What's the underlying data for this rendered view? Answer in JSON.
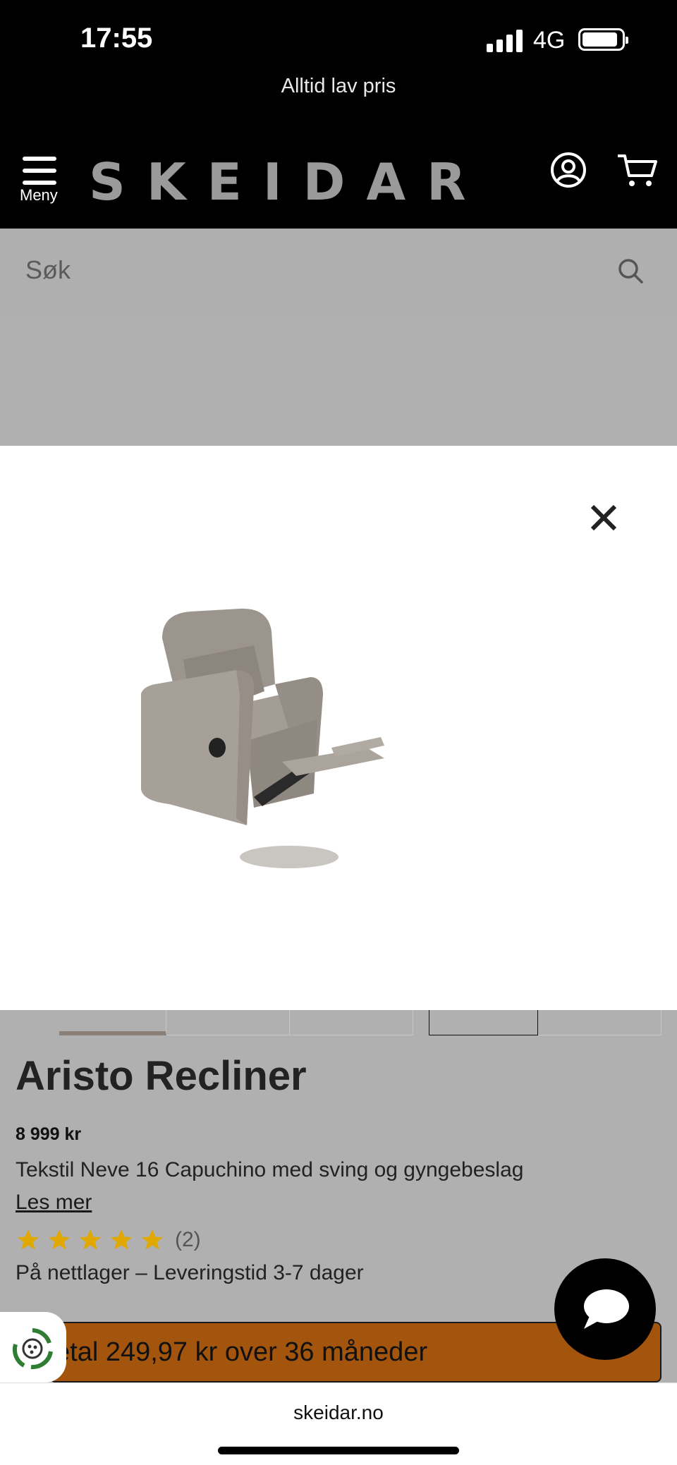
{
  "status_bar": {
    "time": "17:55",
    "network": "4G",
    "signal_bars": 4,
    "battery_level": 0.9
  },
  "banner": {
    "text": "Alltid lav pris"
  },
  "header": {
    "menu_label": "Meny",
    "logo": "SKEIDAR",
    "account_icon": "account-icon",
    "cart_icon": "cart-icon"
  },
  "search": {
    "placeholder": "Søk",
    "icon": "search-icon"
  },
  "modal": {
    "close_icon": "close-icon",
    "image_alt": "Aristo Recliner"
  },
  "product": {
    "title": "Aristo Recliner",
    "price": "8 999 kr",
    "description": "Tekstil Neve 16 Capuchino med sving og gyngebeslag",
    "read_more": "Les mer",
    "rating_stars": 5,
    "rating_count": "(2)",
    "stock": "På nettlager – Leveringstid 3-7 dager"
  },
  "finance": {
    "text": "etal 249,97 kr over 36 måneder"
  },
  "chat": {
    "icon": "chat-bubble-icon"
  },
  "browser": {
    "url": "skeidar.no"
  },
  "colors": {
    "star": "#e0a800",
    "finance_bg": "#a3540d",
    "header_bg": "#000000"
  }
}
